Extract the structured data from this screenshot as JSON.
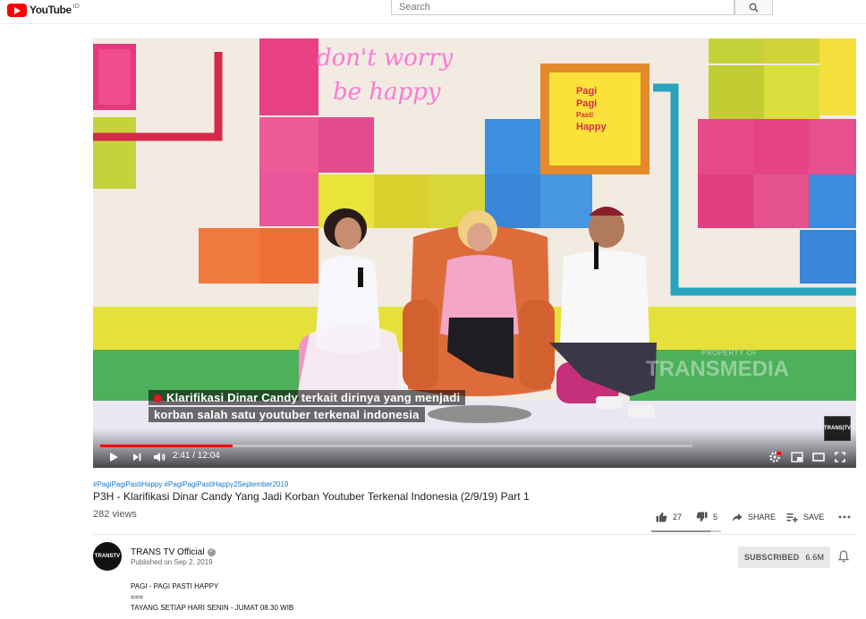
{
  "masthead": {
    "logo_text": "YouTube",
    "country": "ID",
    "search_placeholder": "Search"
  },
  "player": {
    "subtitle_line_1": "Klarifikasi Dinar Candy terkait dirinya yang menjadi",
    "subtitle_line_2": "korban salah satu youtuber terkenal indonesia",
    "watermark_property": "PROPERTY OF",
    "watermark_brand": "TRANSMEDIA",
    "channel_bug": "TRANS|TV",
    "current_time": "2:41",
    "duration": "12:04",
    "time_label": "2:41 / 12:04",
    "progress_fraction": 0.223,
    "buffered_fraction": 1.0,
    "set_sign_lines": [
      "don't worry",
      "be happy"
    ],
    "show_logo_lines": [
      "Pagi",
      "Pagi",
      "Pasti",
      "Happy"
    ]
  },
  "video": {
    "hashtags": "#PagiPagiPastiHappy #PagiPagiPastiHappy2September2019",
    "title": "P3H - Klarifikasi Dinar Candy Yang Jadi Korban Youtuber Terkenal Indonesia (2/9/19) Part 1",
    "views": "282 views",
    "likes": "27",
    "dislikes": "5",
    "share_label": "SHARE",
    "save_label": "SAVE",
    "like_fraction": 0.844
  },
  "channel": {
    "name": "TRANS TV Official",
    "avatar_text": "TRANSTV",
    "published": "Published on Sep 2, 2019",
    "subscribe_label": "SUBSCRIBED",
    "subscriber_count": "6.6M"
  },
  "description": {
    "lines": [
      "PAGI - PAGI PASTI HAPPY",
      "===",
      "TAYANG SETIAP HARI SENIN - JUMAT 08.30 WIB"
    ]
  },
  "colors": {
    "brand_red": "#ff0000",
    "link_blue": "#167ac6"
  }
}
